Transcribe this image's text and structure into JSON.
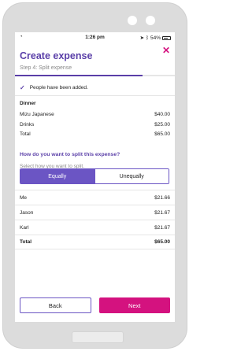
{
  "status_bar": {
    "time": "1:26 pm",
    "battery": "54%",
    "wifi_icon": "wifi-icon"
  },
  "header": {
    "title": "Create expense",
    "close_icon": "✕",
    "step": "Step 4: Split expense",
    "progress": 0.8
  },
  "notice": {
    "icon": "✓",
    "text": "People have been added."
  },
  "expense": {
    "title": "Dinner",
    "items": [
      {
        "label": "Mizu Japanese",
        "amount": "$40.00"
      },
      {
        "label": "Drinks",
        "amount": "$25.00"
      },
      {
        "label": "Total",
        "amount": "$65.00"
      }
    ]
  },
  "split": {
    "question": "How do you want to split this expense?",
    "hint": "Select how you want to split.",
    "options": [
      "Equally",
      "Unequally"
    ],
    "selected": "Equally"
  },
  "people": [
    {
      "name": "Me",
      "amount": "$21.66"
    },
    {
      "name": "Jason",
      "amount": "$21.67"
    },
    {
      "name": "Karl",
      "amount": "$21.67"
    }
  ],
  "total": {
    "label": "Total",
    "amount": "$65.00"
  },
  "buttons": {
    "back": "Back",
    "next": "Next"
  },
  "colors": {
    "accent": "#5a3fa8",
    "segment": "#6b55c4",
    "primary_button": "#d4127f"
  }
}
